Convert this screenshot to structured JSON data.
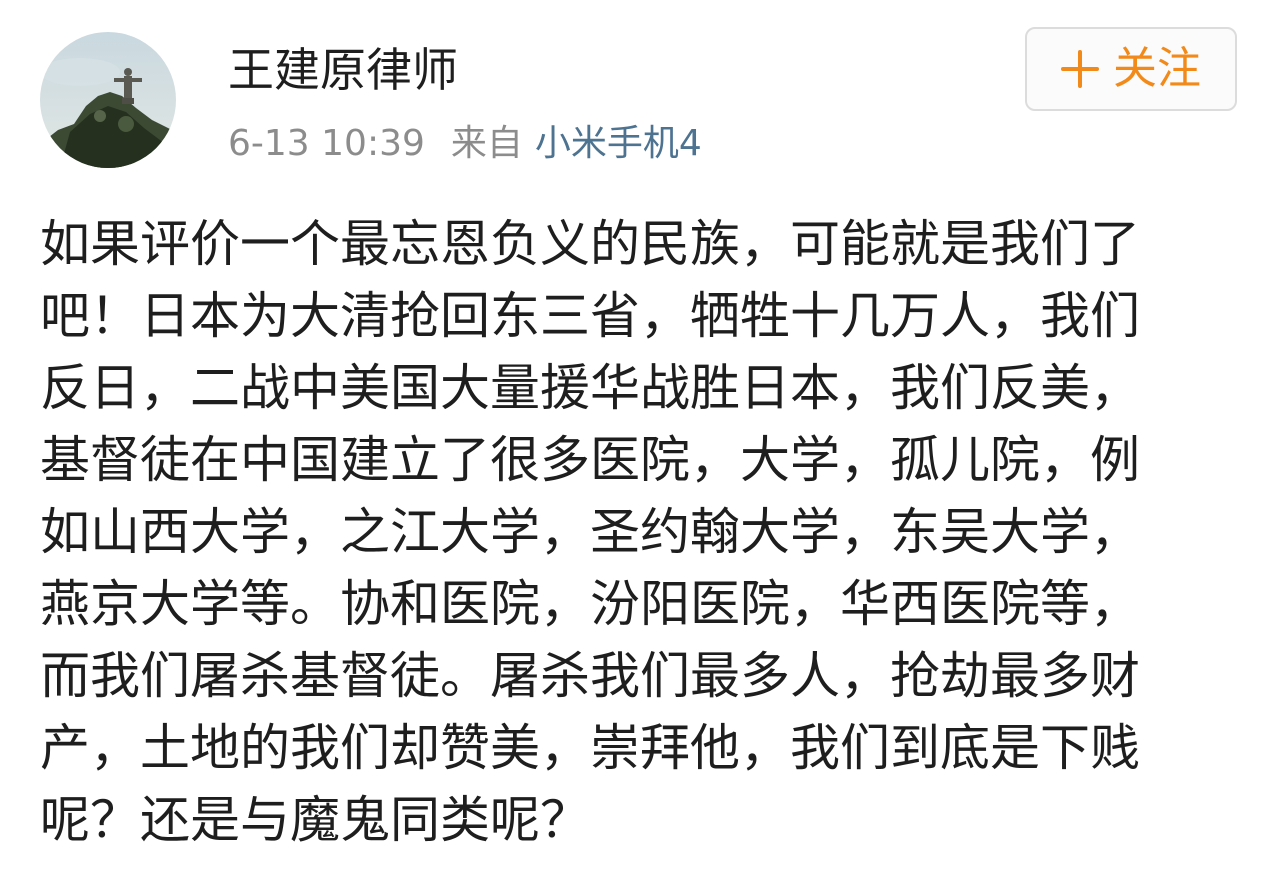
{
  "post": {
    "author": {
      "name": "王建原律师",
      "avatar_icon": "avatar-christ-statue"
    },
    "meta": {
      "time": "6-13 10:39",
      "from_label": "来自",
      "device": "小米手机4"
    },
    "follow_button": {
      "icon": "plus-icon",
      "label": "关注"
    },
    "content_lines": [
      "如果评价一个最忘恩负义的民族，可能就是我们了",
      "吧！日本为大清抢回东三省，牺牲十几万人，我们",
      "反日，二战中美国大量援华战胜日本，我们反美，",
      "基督徒在中国建立了很多医院，大学，孤儿院，例",
      "如山西大学，之江大学，圣约翰大学，东吴大学，",
      "燕京大学等。协和医院，汾阳医院，华西医院等，",
      "而我们屠杀基督徒。屠杀我们最多人，抢劫最多财",
      "产，土地的我们却赞美，崇拜他，我们到底是下贱",
      "呢？还是与魔鬼同类呢？"
    ]
  },
  "colors": {
    "text": "#1e1e1e",
    "meta_gray": "#8c8c8c",
    "device_link": "#4d7391",
    "follow_accent": "#f28a1a",
    "button_border": "#dcdcdc"
  }
}
